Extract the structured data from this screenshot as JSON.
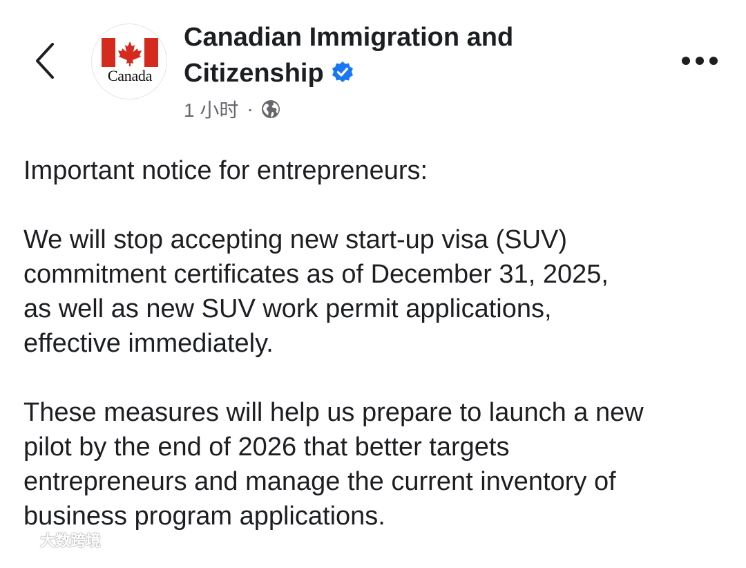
{
  "header": {
    "back_icon": "chevron-left-icon",
    "avatar_wordmark": "Canada",
    "page_name_line1": "Canadian Immigration and",
    "page_name_line2": "Citizenship",
    "verified_icon": "verified-badge-icon",
    "verified_color": "#1877f2",
    "timestamp": "1 小时",
    "separator": "·",
    "audience_icon": "globe-icon",
    "more_icon": "ellipsis-icon"
  },
  "post": {
    "heading": "Important notice for entrepreneurs:",
    "paragraph1": [
      "We will stop accepting new start-up visa (SUV)",
      "commitment certificates as of December 31, 2025,",
      "as well as new SUV work permit applications,",
      "effective immediately."
    ],
    "paragraph2": [
      "These measures will help us prepare to launch a new",
      "pilot by the end of 2026 that better targets",
      "entrepreneurs and manage the current inventory of",
      "business program applications."
    ]
  },
  "watermark": {
    "text": "大数跨境"
  },
  "colors": {
    "flag_red": "#d52b1e",
    "text_primary": "#1c1e21",
    "text_secondary": "#65676b"
  }
}
